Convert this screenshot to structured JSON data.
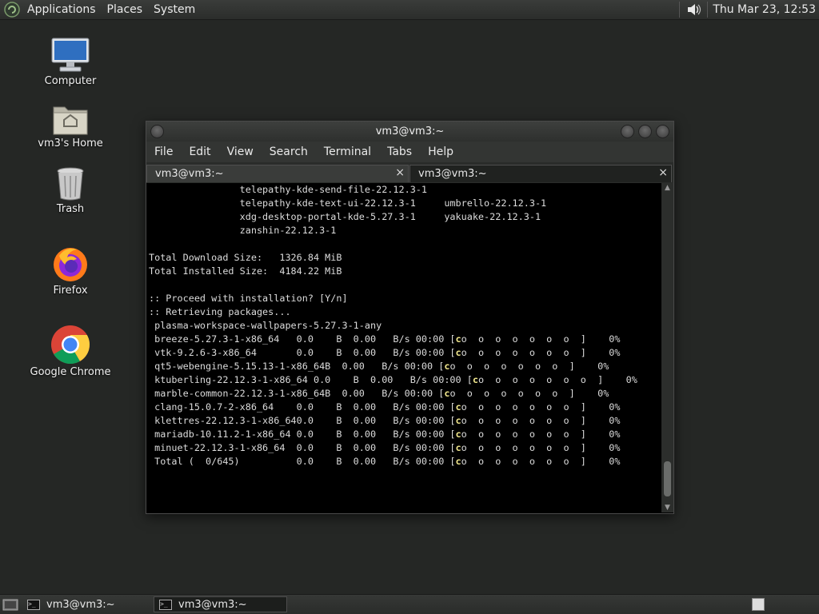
{
  "top_panel": {
    "menus": [
      "Applications",
      "Places",
      "System"
    ],
    "clock": "Thu Mar 23, 12:53"
  },
  "desktop_icons": [
    {
      "label": "Computer",
      "icon": "computer-icon"
    },
    {
      "label": "vm3's Home",
      "icon": "home-folder-icon"
    },
    {
      "label": "Trash",
      "icon": "trash-icon"
    },
    {
      "label": "Firefox",
      "icon": "firefox-icon"
    },
    {
      "label": "Google Chrome",
      "icon": "chrome-icon"
    }
  ],
  "window": {
    "title": "vm3@vm3:~",
    "menu": [
      "File",
      "Edit",
      "View",
      "Search",
      "Terminal",
      "Tabs",
      "Help"
    ],
    "tabs": [
      {
        "label": "vm3@vm3:~",
        "close": "×"
      },
      {
        "label": "vm3@vm3:~",
        "close": "×"
      }
    ]
  },
  "terminal": {
    "packages": [
      {
        "a": "telepathy-kde-send-file-22.12.3-1",
        "b": ""
      },
      {
        "a": "telepathy-kde-text-ui-22.12.3-1",
        "b": "umbrello-22.12.3-1"
      },
      {
        "a": "xdg-desktop-portal-kde-5.27.3-1",
        "b": "yakuake-22.12.3-1"
      },
      {
        "a": "zanshin-22.12.3-1",
        "b": ""
      }
    ],
    "download_size": "Total Download Size:   1326.84 MiB",
    "installed_size": "Total Installed Size:  4184.22 MiB",
    "proceed": ":: Proceed with installation? [Y/n]",
    "retrieving": ":: Retrieving packages...",
    "first_pkg": " plasma-workspace-wallpapers-5.27.3-1-any",
    "rows": [
      {
        "name": "breeze-5.27.3-1-x86_64  ",
        "size": "0.0",
        "speed": "0.00",
        "time": "00:00",
        "pct": "0%"
      },
      {
        "name": "vtk-9.2.6-3-x86_64      ",
        "size": "0.0",
        "speed": "0.00",
        "time": "00:00",
        "pct": "0%"
      },
      {
        "name": "qt5-webengine-5.15.13-1-x86_64",
        "size": "B",
        "speed": "0.00",
        "time": "00:00",
        "pct": "0%"
      },
      {
        "name": "ktuberling-22.12.3-1-x86_64 ",
        "size": "0.0",
        "speed": "0.00",
        "time": "00:00",
        "pct": "0%"
      },
      {
        "name": "marble-common-22.12.3-1-x86_64",
        "size": "B",
        "speed": "0.00",
        "time": "00:00",
        "pct": "0%"
      },
      {
        "name": "clang-15.0.7-2-x86_64   ",
        "size": "0.0",
        "speed": "0.00",
        "time": "00:00",
        "pct": "0%"
      },
      {
        "name": "klettres-22.12.3-1-x86_64",
        "size": "0.0",
        "speed": "0.00",
        "time": "00:00",
        "pct": "0%"
      },
      {
        "name": "mariadb-10.11.2-1-x86_64",
        "size": "0.0",
        "speed": "0.00",
        "time": "00:00",
        "pct": "0%"
      },
      {
        "name": "minuet-22.12.3-1-x86_64 ",
        "size": "0.0",
        "speed": "0.00",
        "time": "00:00",
        "pct": "0%"
      },
      {
        "name": "Total (  0/645)         ",
        "size": "0.0",
        "speed": "0.00",
        "time": "00:00",
        "pct": "0%"
      }
    ]
  },
  "bottom_panel": {
    "tasks": [
      {
        "label": "vm3@vm3:~"
      },
      {
        "label": "vm3@vm3:~"
      }
    ]
  }
}
